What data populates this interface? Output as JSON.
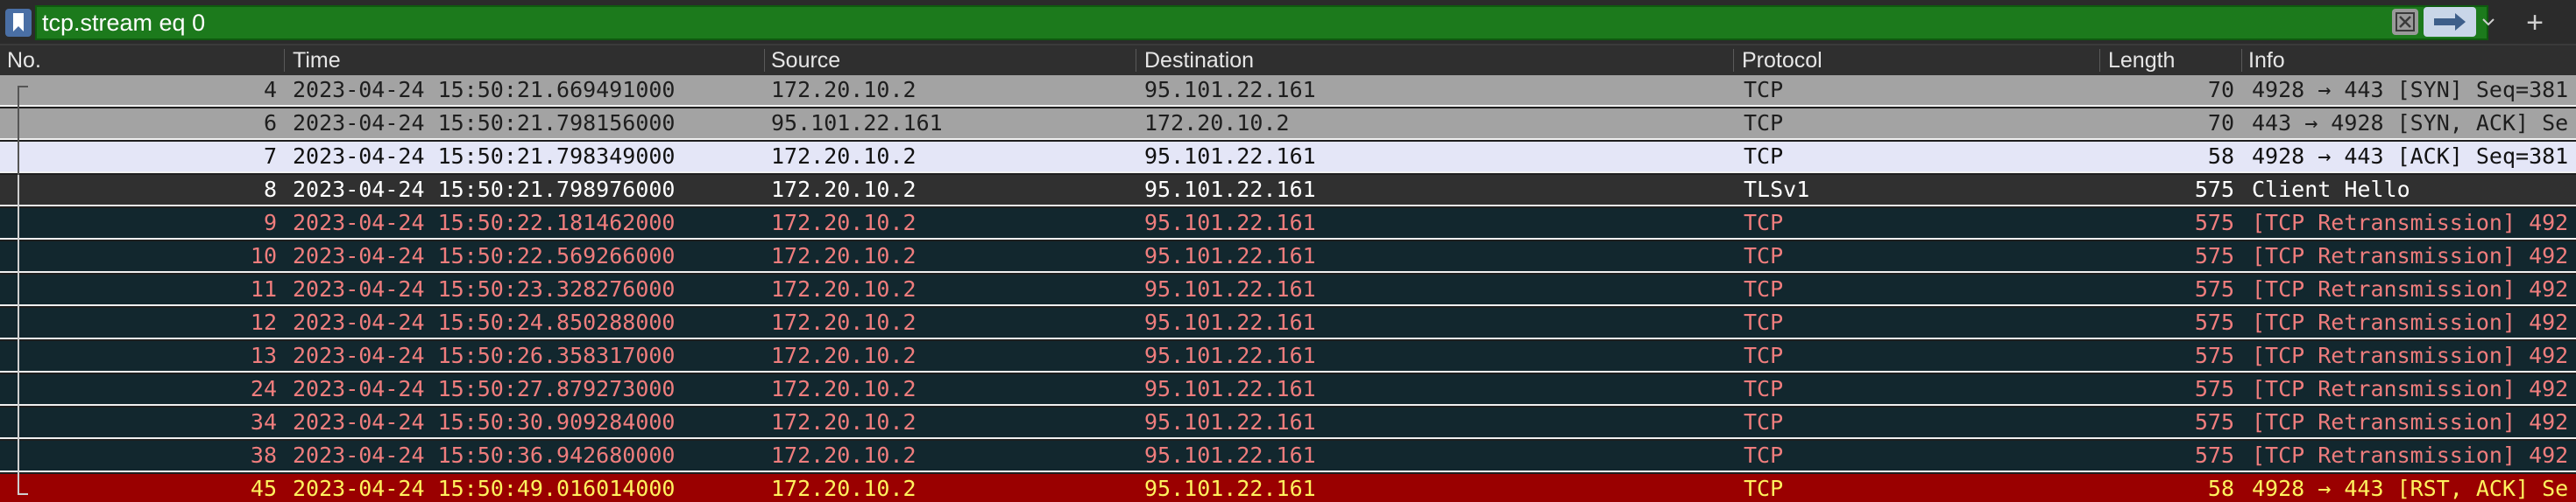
{
  "filter": {
    "value": "tcp.stream eq 0",
    "placeholder": ""
  },
  "columns": {
    "no": "No.",
    "time": "Time",
    "source": "Source",
    "destination": "Destination",
    "protocol": "Protocol",
    "length": "Length",
    "info": "Info"
  },
  "toolbar": {
    "add_button": "+"
  },
  "colors": {
    "filter_valid_bg": "#1c7a1c",
    "row_gray_bg": "#a3a3a3",
    "row_selected_bg": "#e4e6f7",
    "row_dark_bg": "#303030",
    "row_retrans_bg": "#12272e",
    "row_retrans_fg": "#ef7d7d",
    "row_rst_bg": "#9a0000",
    "row_rst_fg": "#fff25e"
  },
  "packets": [
    {
      "no": "4",
      "time": "2023-04-24 15:50:21.669491000",
      "source": "172.20.10.2",
      "destination": "95.101.22.161",
      "protocol": "TCP",
      "length": "70",
      "info": "4928 → 443 [SYN] Seq=381",
      "style": "gray"
    },
    {
      "no": "6",
      "time": "2023-04-24 15:50:21.798156000",
      "source": "95.101.22.161",
      "destination": "172.20.10.2",
      "protocol": "TCP",
      "length": "70",
      "info": "443 → 4928 [SYN, ACK] Se",
      "style": "gray"
    },
    {
      "no": "7",
      "time": "2023-04-24 15:50:21.798349000",
      "source": "172.20.10.2",
      "destination": "95.101.22.161",
      "protocol": "TCP",
      "length": "58",
      "info": "4928 → 443 [ACK] Seq=381",
      "style": "selected"
    },
    {
      "no": "8",
      "time": "2023-04-24 15:50:21.798976000",
      "source": "172.20.10.2",
      "destination": "95.101.22.161",
      "protocol": "TLSv1",
      "length": "575",
      "info": "Client Hello",
      "style": "dark"
    },
    {
      "no": "9",
      "time": "2023-04-24 15:50:22.181462000",
      "source": "172.20.10.2",
      "destination": "95.101.22.161",
      "protocol": "TCP",
      "length": "575",
      "info": "[TCP Retransmission] 492",
      "style": "retrans"
    },
    {
      "no": "10",
      "time": "2023-04-24 15:50:22.569266000",
      "source": "172.20.10.2",
      "destination": "95.101.22.161",
      "protocol": "TCP",
      "length": "575",
      "info": "[TCP Retransmission] 492",
      "style": "retrans"
    },
    {
      "no": "11",
      "time": "2023-04-24 15:50:23.328276000",
      "source": "172.20.10.2",
      "destination": "95.101.22.161",
      "protocol": "TCP",
      "length": "575",
      "info": "[TCP Retransmission] 492",
      "style": "retrans"
    },
    {
      "no": "12",
      "time": "2023-04-24 15:50:24.850288000",
      "source": "172.20.10.2",
      "destination": "95.101.22.161",
      "protocol": "TCP",
      "length": "575",
      "info": "[TCP Retransmission] 492",
      "style": "retrans"
    },
    {
      "no": "13",
      "time": "2023-04-24 15:50:26.358317000",
      "source": "172.20.10.2",
      "destination": "95.101.22.161",
      "protocol": "TCP",
      "length": "575",
      "info": "[TCP Retransmission] 492",
      "style": "retrans"
    },
    {
      "no": "24",
      "time": "2023-04-24 15:50:27.879273000",
      "source": "172.20.10.2",
      "destination": "95.101.22.161",
      "protocol": "TCP",
      "length": "575",
      "info": "[TCP Retransmission] 492",
      "style": "retrans"
    },
    {
      "no": "34",
      "time": "2023-04-24 15:50:30.909284000",
      "source": "172.20.10.2",
      "destination": "95.101.22.161",
      "protocol": "TCP",
      "length": "575",
      "info": "[TCP Retransmission] 492",
      "style": "retrans"
    },
    {
      "no": "38",
      "time": "2023-04-24 15:50:36.942680000",
      "source": "172.20.10.2",
      "destination": "95.101.22.161",
      "protocol": "TCP",
      "length": "575",
      "info": "[TCP Retransmission] 492",
      "style": "retrans"
    },
    {
      "no": "45",
      "time": "2023-04-24 15:50:49.016014000",
      "source": "172.20.10.2",
      "destination": "95.101.22.161",
      "protocol": "TCP",
      "length": "58",
      "info": "4928 → 443 [RST, ACK] Se",
      "style": "rst"
    }
  ]
}
